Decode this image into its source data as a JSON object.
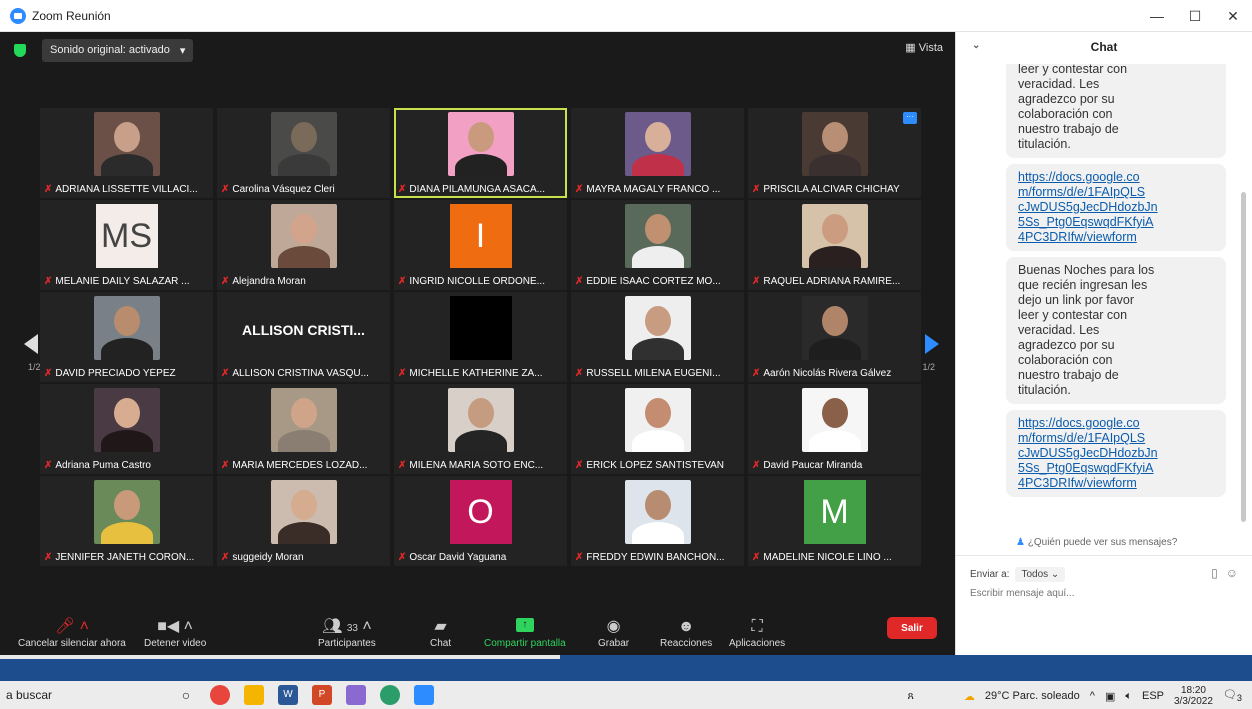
{
  "window": {
    "title": "Zoom Reunión",
    "minimize": "—",
    "maximize": "☐",
    "close": "✕"
  },
  "topbar": {
    "audio_label": "Sonido original: activado",
    "audio_chevron": "▾",
    "view_label": "Vista",
    "view_icon": "▦"
  },
  "participants": [
    {
      "name": "ADRIANA LISSETTE VILLACI...",
      "type": "photo",
      "bg": "#6b5048",
      "skin": "#c8a08a",
      "shirt": "#2b2b2b"
    },
    {
      "name": "Carolina Vásquez Cleri",
      "type": "photo",
      "bg": "#4a4a48",
      "skin": "#7a6a5a",
      "shirt": "#3a3a3a"
    },
    {
      "name": "DIANA PILAMUNGA ASACA...",
      "type": "photo",
      "bg": "#f2a0c4",
      "skin": "#c99a7e",
      "shirt": "#222222",
      "active": true
    },
    {
      "name": "MAYRA MAGALY FRANCO ...",
      "type": "photo",
      "bg": "#6c5a8a",
      "skin": "#d8b09a",
      "shirt": "#c03048"
    },
    {
      "name": "PRISCILA ALCIVAR CHICHAY",
      "type": "photo",
      "bg": "#4a3a34",
      "skin": "#b88f74",
      "shirt": "#3a3030",
      "more": true
    },
    {
      "name": "MELANIE DAILY SALAZAR ...",
      "type": "initials",
      "initials": "MS",
      "bg": "#f4ece8",
      "fg": "#444444"
    },
    {
      "name": "Alejandra Moran",
      "type": "photo",
      "bg": "#bfa897",
      "skin": "#d2a48c",
      "shirt": "#6a4a3a"
    },
    {
      "name": "INGRID NICOLLE ORDOÑE...",
      "type": "initials",
      "initials": "I",
      "bg": "#ef6c11",
      "fg": "#ffffff"
    },
    {
      "name": "EDDIE ISAAC CORTEZ MO...",
      "type": "photo",
      "bg": "#5a6a5a",
      "skin": "#c09070",
      "shirt": "#eeeeee"
    },
    {
      "name": "RAQUEL ADRIANA RAMIRE...",
      "type": "photo",
      "bg": "#d6c2a8",
      "skin": "#cc9c80",
      "shirt": "#2a2020"
    },
    {
      "name": "DAVID PRECIADO YÉPEZ",
      "type": "photo",
      "bg": "#7a8088",
      "skin": "#b88c6c",
      "shirt": "#222222"
    },
    {
      "name": "ALLISON CRISTINA VASQU...",
      "type": "big",
      "big": "ALLISON CRISTI..."
    },
    {
      "name": "MICHELLE KATHERINE ZA...",
      "type": "initials",
      "initials": "",
      "bg": "#000000",
      "fg": "#ffffff"
    },
    {
      "name": "RUSSELL MILENA EUGENI...",
      "type": "photo",
      "bg": "#eeeeee",
      "skin": "#c89c80",
      "shirt": "#303030"
    },
    {
      "name": "Aarón Nicolás Rivera Gálvez",
      "type": "photo",
      "bg": "#2a2a2a",
      "skin": "#b08468",
      "shirt": "#1e1e1e"
    },
    {
      "name": "Adriana Puma Castro",
      "type": "photo",
      "bg": "#4a3a44",
      "skin": "#d8ac90",
      "shirt": "#201818"
    },
    {
      "name": "MARIA MERCEDES LOZAD...",
      "type": "photo",
      "bg": "#a89886",
      "skin": "#d0a488",
      "shirt": "#8a7e72"
    },
    {
      "name": "MILENA MARIA SOTO ENC...",
      "type": "photo",
      "bg": "#d8d0c8",
      "skin": "#c69c80",
      "shirt": "#242424"
    },
    {
      "name": "ERICK LÓPEZ SANTISTEVAN",
      "type": "photo",
      "bg": "#f0f0f0",
      "skin": "#c48c70",
      "shirt": "#ffffff"
    },
    {
      "name": "David Paucar Miranda",
      "type": "photo",
      "bg": "#f6f6f6",
      "skin": "#8a6048",
      "shirt": "#ffffff"
    },
    {
      "name": "JENNIFER JANETH CORON...",
      "type": "photo",
      "bg": "#6a8a5a",
      "skin": "#c89a7a",
      "shirt": "#e8c040"
    },
    {
      "name": "suggeidy Moran",
      "type": "photo",
      "bg": "#ccbcb0",
      "skin": "#d6ac90",
      "shirt": "#3a2c26"
    },
    {
      "name": "Oscar David Yaguana",
      "type": "initials",
      "initials": "O",
      "bg": "#c2185b",
      "fg": "#ffffff"
    },
    {
      "name": "FREDDY EDWIN BANCHON...",
      "type": "photo",
      "bg": "#dde4ec",
      "skin": "#b88c70",
      "shirt": "#ffffff"
    },
    {
      "name": "MADELINE NICOLE LINO ...",
      "type": "initials",
      "initials": "M",
      "bg": "#43a047",
      "fg": "#ffffff"
    }
  ],
  "paging": {
    "left": "1/2",
    "right": "1/2"
  },
  "toolbar": {
    "unmute": "Cancelar silenciar ahora",
    "video": "Detener video",
    "participants": "Participantes",
    "participants_count": "33",
    "chat": "Chat",
    "share": "Compartir pantalla",
    "record": "Grabar",
    "reactions": "Reacciones",
    "apps": "Aplicaciones",
    "leave": "Salir"
  },
  "chat": {
    "title": "Chat",
    "messages": [
      {
        "text": "leer y contestar con\nveracidad. Les\nagradezco por su\ncolaboración con\nnuestro trabajo de\ntitulación.",
        "link": false
      },
      {
        "text": "https://docs.google.co\nm/forms/d/e/1FAIpQLS\ncJwDUS5gJecDHdozbJn\n5Ss_Ptg0EqswqdFKfyiA\n4PC3DRIfw/viewform",
        "link": true
      },
      {
        "text": "Buenas Noches para los\nque recién ingresan les\ndejo un link por favor\nleer y contestar con\nveracidad. Les\nagradezco por su\ncolaboración con\nnuestro trabajo de\ntitulación.",
        "link": false
      },
      {
        "text": "https://docs.google.co\nm/forms/d/e/1FAIpQLS\ncJwDUS5gJecDHdozbJn\n5Ss_Ptg0EqswqdFKfyiA\n4PC3DRIfw/viewform",
        "link": true
      }
    ],
    "who_can_see": "¿Quién puede ver sus mensajes?",
    "send_to_label": "Enviar a:",
    "send_to_value": "Todos",
    "input_placeholder": "Escribir mensaje aquí..."
  },
  "taskbar": {
    "search": "a buscar",
    "weather": "29°C  Parc. soleado",
    "lang": "ESP",
    "time": "18:20",
    "date": "3/3/2022",
    "notif": "3"
  }
}
